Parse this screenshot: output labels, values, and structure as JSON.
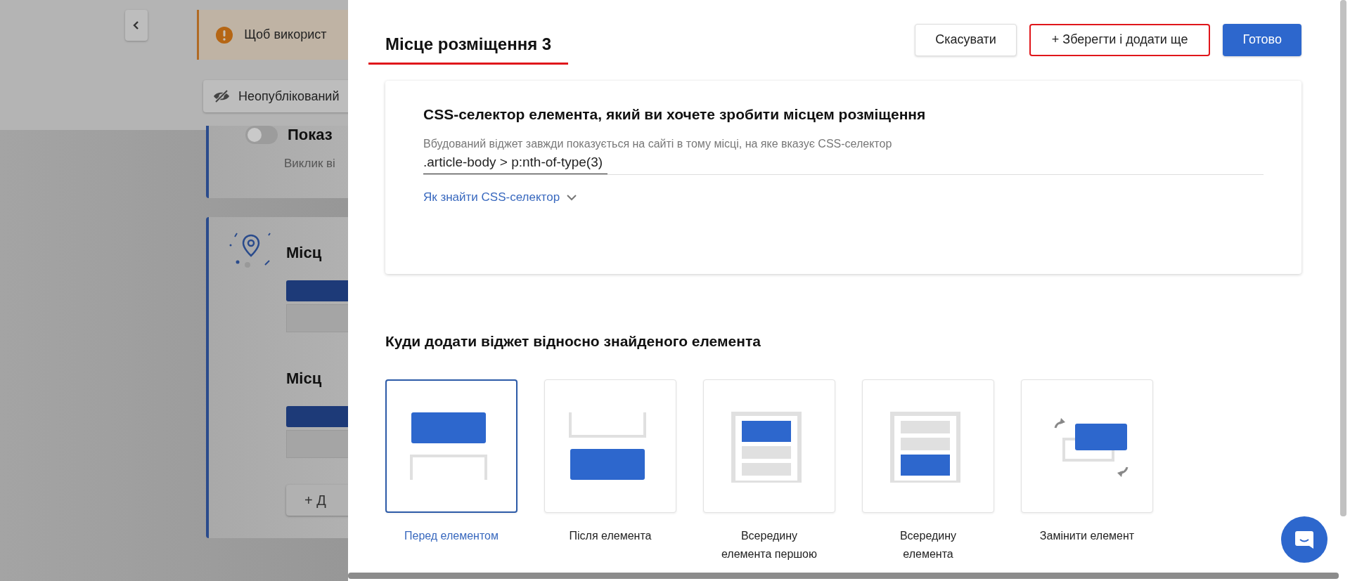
{
  "background_page": {
    "notice": "Щоб використ",
    "status": "Неопублікований",
    "toggle_card": {
      "title": "Показ",
      "subtitle": "Виклик ві",
      "on": false
    },
    "placement_card": {
      "sections": [
        "Місц",
        "Місц"
      ],
      "add_button": "+ Д"
    }
  },
  "dialog": {
    "title": "Місце розміщення 3",
    "buttons": [
      {
        "label": "Скасувати",
        "kind": "secondary"
      },
      {
        "label": "+ Зберегти і додати ще",
        "kind": "highlighted"
      },
      {
        "label": "Готово",
        "kind": "primary"
      }
    ],
    "selector": {
      "heading": "CSS-селектор елемента, який ви хочете зробити місцем розміщення",
      "description": "Вбудований віджет завжди показується на сайті в тому місці, на яке вказує CSS-селектор",
      "value": ".article-body > p:nth-of-type(3)",
      "help_link": "Як знайти CSS-селектор"
    },
    "position": {
      "heading": "Куди додати віджет відносно знайденого елемента",
      "options": [
        {
          "label": "Перед елементом",
          "kind": "before",
          "selected": true
        },
        {
          "label": "Після елемента",
          "kind": "after",
          "selected": false
        },
        {
          "label": "Всередину елемента першою",
          "kind": "inside_first",
          "selected": false
        },
        {
          "label": "Всередину елемента",
          "kind": "inside_last",
          "selected": false
        },
        {
          "label": "Замінити елемент",
          "kind": "replace",
          "selected": false
        }
      ]
    }
  }
}
